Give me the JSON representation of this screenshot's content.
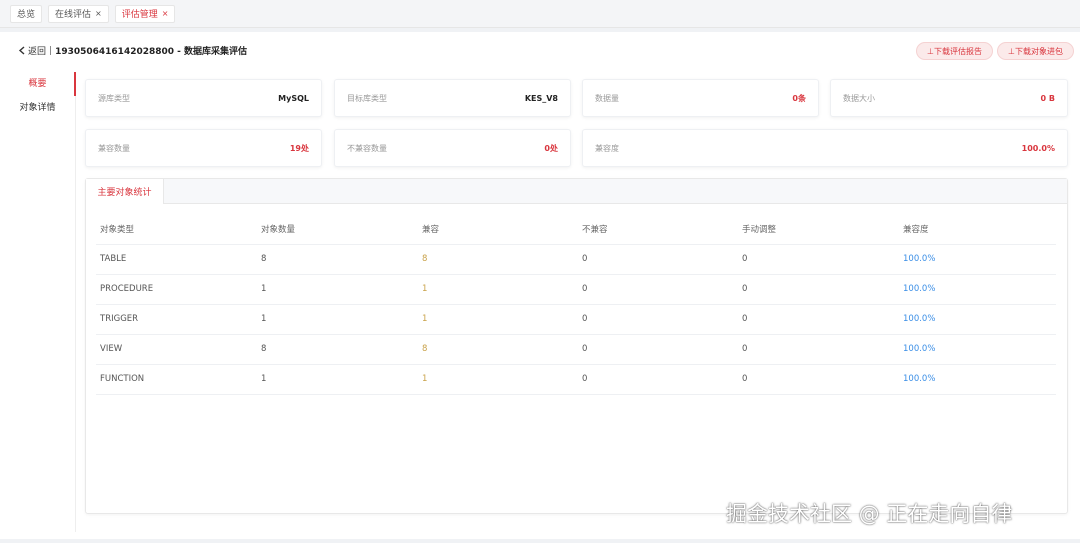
{
  "tabs": [
    {
      "label": "总览",
      "closable": false,
      "active": false
    },
    {
      "label": "在线评估",
      "closable": true,
      "active": false
    },
    {
      "label": "评估管理",
      "closable": true,
      "active": true
    }
  ],
  "close_glyph": "×",
  "header": {
    "back_label": "返回",
    "separator": "|",
    "title": "1930506416142028800 - 数据库采集评估",
    "download_report": "⊥下载评估报告",
    "download_objects": "⊥下载对象进包"
  },
  "sidebar": {
    "items": [
      {
        "label": "概要",
        "active": true
      },
      {
        "label": "对象详情",
        "active": false
      }
    ]
  },
  "summary": {
    "row1": [
      {
        "label": "源库类型",
        "value": "MySQL"
      },
      {
        "label": "目标库类型",
        "value": "KES_V8"
      },
      {
        "label": "数据量",
        "value": "0条"
      },
      {
        "label": "数据大小",
        "value": "0 B"
      }
    ],
    "row2": [
      {
        "label": "兼容数量",
        "value": "19处"
      },
      {
        "label": "不兼容数量",
        "value": "0处"
      },
      {
        "label": "兼容度",
        "value": "100.0%"
      }
    ]
  },
  "panel": {
    "tab_label": "主要对象统计",
    "columns": [
      "对象类型",
      "对象数量",
      "兼容",
      "不兼容",
      "手动调整",
      "兼容度"
    ],
    "rows": [
      [
        "TABLE",
        "8",
        "8",
        "0",
        "0",
        "100.0%"
      ],
      [
        "PROCEDURE",
        "1",
        "1",
        "0",
        "0",
        "100.0%"
      ],
      [
        "TRIGGER",
        "1",
        "1",
        "0",
        "0",
        "100.0%"
      ],
      [
        "VIEW",
        "8",
        "8",
        "0",
        "0",
        "100.0%"
      ],
      [
        "FUNCTION",
        "1",
        "1",
        "0",
        "0",
        "100.0%"
      ]
    ]
  },
  "watermark": "掘金技术社区 @ 正在走向自律",
  "colors": {
    "accent": "#d9363e",
    "compatible": "#c9a24a",
    "percent": "#3a8ee6"
  },
  "icons": {
    "back": "chevron-left-icon",
    "download": "download-icon",
    "close": "close-icon"
  }
}
